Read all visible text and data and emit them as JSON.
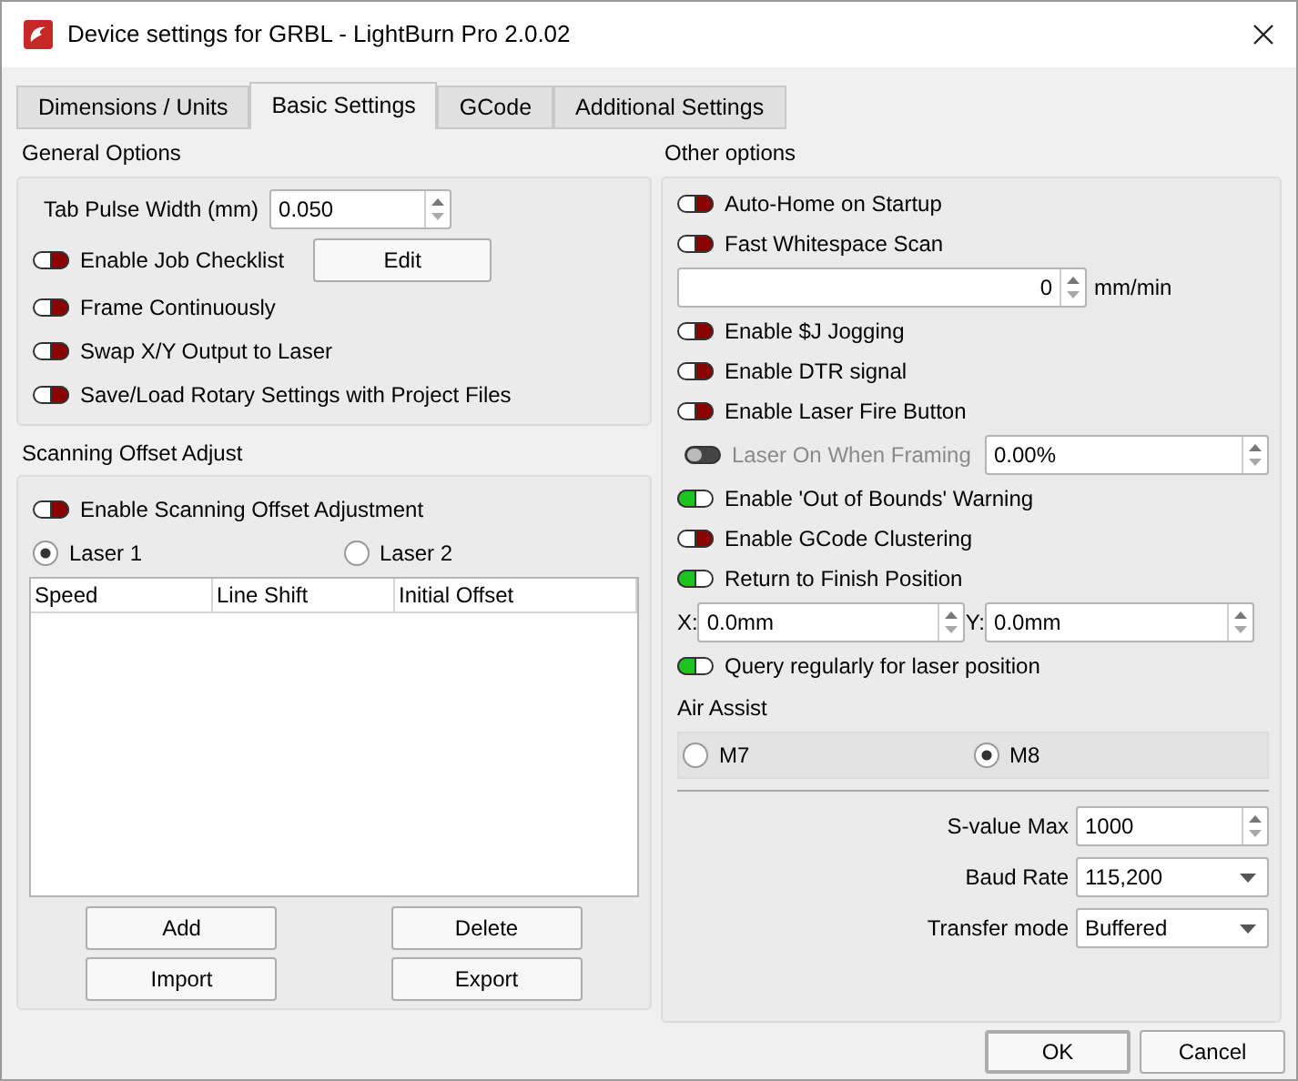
{
  "window": {
    "title": "Device settings for GRBL - LightBurn Pro 2.0.02"
  },
  "tabs": [
    {
      "label": "Dimensions / Units",
      "selected": false
    },
    {
      "label": "Basic Settings",
      "selected": true
    },
    {
      "label": "GCode",
      "selected": false
    },
    {
      "label": "Additional Settings",
      "selected": false
    }
  ],
  "general_options": {
    "title": "General Options",
    "tab_pulse": {
      "label": "Tab Pulse Width (mm)",
      "value": "0.050"
    },
    "toggles": [
      {
        "label": "Enable Job Checklist",
        "on": false,
        "button": "Edit"
      },
      {
        "label": "Frame Continuously",
        "on": false
      },
      {
        "label": "Swap X/Y Output to Laser",
        "on": false
      },
      {
        "label": "Save/Load Rotary Settings with Project Files",
        "on": false
      }
    ]
  },
  "scanning_offset": {
    "title": "Scanning Offset Adjust",
    "toggle": {
      "label": "Enable Scanning Offset Adjustment",
      "on": false
    },
    "lasers": [
      {
        "label": "Laser 1",
        "selected": true
      },
      {
        "label": "Laser 2",
        "selected": false
      }
    ],
    "columns": [
      "Speed",
      "Line Shift",
      "Initial Offset"
    ],
    "buttons": [
      "Add",
      "Delete",
      "Import",
      "Export"
    ]
  },
  "other_options": {
    "title": "Other options",
    "items": [
      {
        "kind": "toggle",
        "label": "Auto-Home on Startup",
        "on": false
      },
      {
        "kind": "toggle",
        "label": "Fast Whitespace Scan",
        "on": false
      },
      {
        "kind": "spin",
        "value": "0",
        "unit": "mm/min"
      },
      {
        "kind": "toggle",
        "label": "Enable $J Jogging",
        "on": false
      },
      {
        "kind": "toggle",
        "label": "Enable DTR signal",
        "on": false
      },
      {
        "kind": "toggle",
        "label": "Enable Laser Fire Button",
        "on": false
      },
      {
        "kind": "toggle_field",
        "label": "Laser On When Framing",
        "on": false,
        "disabled": true,
        "value": "0.00%"
      },
      {
        "kind": "toggle",
        "label": "Enable 'Out of Bounds' Warning",
        "on": true
      },
      {
        "kind": "toggle",
        "label": "Enable GCode Clustering",
        "on": false
      },
      {
        "kind": "toggle",
        "label": "Return to Finish Position",
        "on": true
      },
      {
        "kind": "xy",
        "x_label": "X:",
        "x_value": "0.0mm",
        "y_label": "Y:",
        "y_value": "0.0mm"
      },
      {
        "kind": "toggle",
        "label": "Query regularly for laser position",
        "on": true
      }
    ]
  },
  "air_assist": {
    "title": "Air Assist",
    "options": [
      {
        "label": "M7",
        "selected": false
      },
      {
        "label": "M8",
        "selected": true
      }
    ]
  },
  "device_fields": [
    {
      "kind": "spin",
      "label": "S-value Max",
      "value": "1000"
    },
    {
      "kind": "dropdown",
      "label": "Baud Rate",
      "value": "115,200"
    },
    {
      "kind": "dropdown",
      "label": "Transfer mode",
      "value": "Buffered"
    }
  ],
  "dialog_buttons": [
    {
      "label": "OK",
      "default": true
    },
    {
      "label": "Cancel",
      "default": false
    }
  ]
}
